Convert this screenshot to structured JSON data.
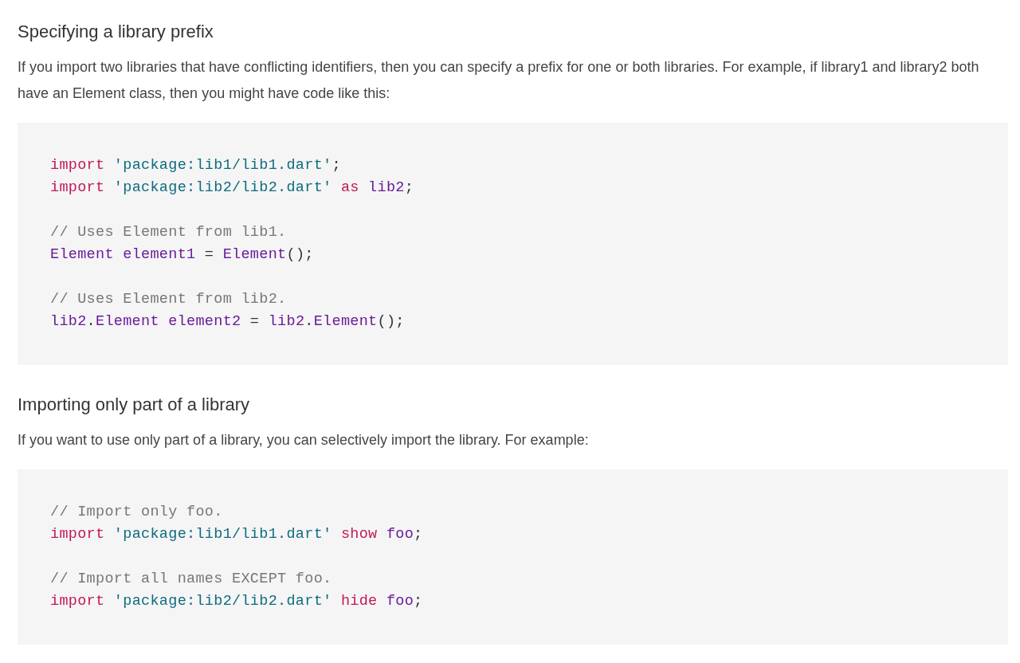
{
  "sections": [
    {
      "heading": "Specifying a library prefix",
      "paragraph": "If you import two libraries that have conflicting identifiers, then you can specify a prefix for one or both libraries. For example, if library1 and library2 both have an Element class, then you might have code like this:",
      "code": [
        {
          "kind": "code",
          "tokens": [
            {
              "kind": "keyword",
              "text": "import "
            },
            {
              "kind": "string",
              "text": "'package:lib1/lib1.dart'"
            },
            {
              "kind": "plain",
              "text": ";"
            }
          ]
        },
        {
          "kind": "code",
          "tokens": [
            {
              "kind": "keyword",
              "text": "import "
            },
            {
              "kind": "string",
              "text": "'package:lib2/lib2.dart' "
            },
            {
              "kind": "keyword",
              "text": "as "
            },
            {
              "kind": "ident",
              "text": "lib2"
            },
            {
              "kind": "plain",
              "text": ";"
            }
          ]
        },
        {
          "kind": "blank"
        },
        {
          "kind": "code",
          "tokens": [
            {
              "kind": "comment",
              "text": "// Uses Element from lib1."
            }
          ]
        },
        {
          "kind": "code",
          "tokens": [
            {
              "kind": "ident",
              "text": "Element element1"
            },
            {
              "kind": "plain",
              "text": " = "
            },
            {
              "kind": "ident",
              "text": "Element"
            },
            {
              "kind": "plain",
              "text": "();"
            }
          ]
        },
        {
          "kind": "blank"
        },
        {
          "kind": "code",
          "tokens": [
            {
              "kind": "comment",
              "text": "// Uses Element from lib2."
            }
          ]
        },
        {
          "kind": "code",
          "tokens": [
            {
              "kind": "ident",
              "text": "lib2"
            },
            {
              "kind": "plain",
              "text": "."
            },
            {
              "kind": "ident",
              "text": "Element element2"
            },
            {
              "kind": "plain",
              "text": " = "
            },
            {
              "kind": "ident",
              "text": "lib2"
            },
            {
              "kind": "plain",
              "text": "."
            },
            {
              "kind": "ident",
              "text": "Element"
            },
            {
              "kind": "plain",
              "text": "();"
            }
          ]
        }
      ]
    },
    {
      "heading": "Importing only part of a library",
      "paragraph": "If you want to use only part of a library, you can selectively import the library. For example:",
      "code": [
        {
          "kind": "code",
          "tokens": [
            {
              "kind": "comment",
              "text": "// Import only foo."
            }
          ]
        },
        {
          "kind": "code",
          "tokens": [
            {
              "kind": "keyword",
              "text": "import "
            },
            {
              "kind": "string",
              "text": "'package:lib1/lib1.dart' "
            },
            {
              "kind": "keyword",
              "text": "show "
            },
            {
              "kind": "ident",
              "text": "foo"
            },
            {
              "kind": "plain",
              "text": ";"
            }
          ]
        },
        {
          "kind": "blank"
        },
        {
          "kind": "code",
          "tokens": [
            {
              "kind": "comment",
              "text": "// Import all names EXCEPT foo."
            }
          ]
        },
        {
          "kind": "code",
          "tokens": [
            {
              "kind": "keyword",
              "text": "import "
            },
            {
              "kind": "string",
              "text": "'package:lib2/lib2.dart' "
            },
            {
              "kind": "keyword",
              "text": "hide "
            },
            {
              "kind": "ident",
              "text": "foo"
            },
            {
              "kind": "plain",
              "text": ";"
            }
          ]
        }
      ]
    }
  ]
}
